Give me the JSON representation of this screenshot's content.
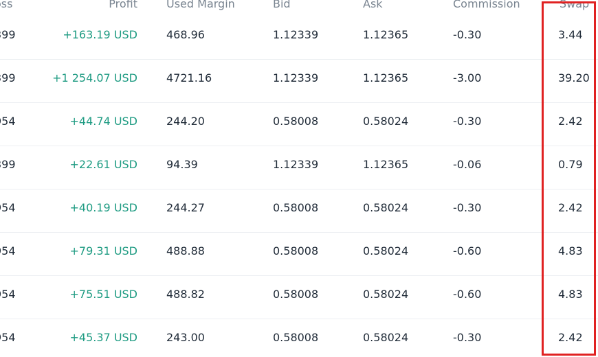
{
  "header": {
    "loss": "oss",
    "profit": "Profit",
    "used_margin": "Used Margin",
    "bid": "Bid",
    "ask": "Ask",
    "commission": "Commission",
    "swap": "Swap"
  },
  "rows": [
    {
      "loss": "399",
      "profit": "+163.19 USD",
      "used_margin": "468.96",
      "bid": "1.12339",
      "ask": "1.12365",
      "commission": "-0.30",
      "swap": "3.44"
    },
    {
      "loss": "399",
      "profit": "+1 254.07 USD",
      "used_margin": "4721.16",
      "bid": "1.12339",
      "ask": "1.12365",
      "commission": "-3.00",
      "swap": "39.20"
    },
    {
      "loss": "954",
      "profit": "+44.74 USD",
      "used_margin": "244.20",
      "bid": "0.58008",
      "ask": "0.58024",
      "commission": "-0.30",
      "swap": "2.42"
    },
    {
      "loss": "399",
      "profit": "+22.61 USD",
      "used_margin": "94.39",
      "bid": "1.12339",
      "ask": "1.12365",
      "commission": "-0.06",
      "swap": "0.79"
    },
    {
      "loss": "954",
      "profit": "+40.19 USD",
      "used_margin": "244.27",
      "bid": "0.58008",
      "ask": "0.58024",
      "commission": "-0.30",
      "swap": "2.42"
    },
    {
      "loss": "954",
      "profit": "+79.31 USD",
      "used_margin": "488.88",
      "bid": "0.58008",
      "ask": "0.58024",
      "commission": "-0.60",
      "swap": "4.83"
    },
    {
      "loss": "954",
      "profit": "+75.51 USD",
      "used_margin": "488.82",
      "bid": "0.58008",
      "ask": "0.58024",
      "commission": "-0.60",
      "swap": "4.83"
    },
    {
      "loss": "954",
      "profit": "+45.37 USD",
      "used_margin": "243.00",
      "bid": "0.58008",
      "ask": "0.58024",
      "commission": "-0.30",
      "swap": "2.42"
    }
  ],
  "colors": {
    "profit": "#1e9b82",
    "highlight": "#e02222",
    "header_text": "#7a8591"
  }
}
